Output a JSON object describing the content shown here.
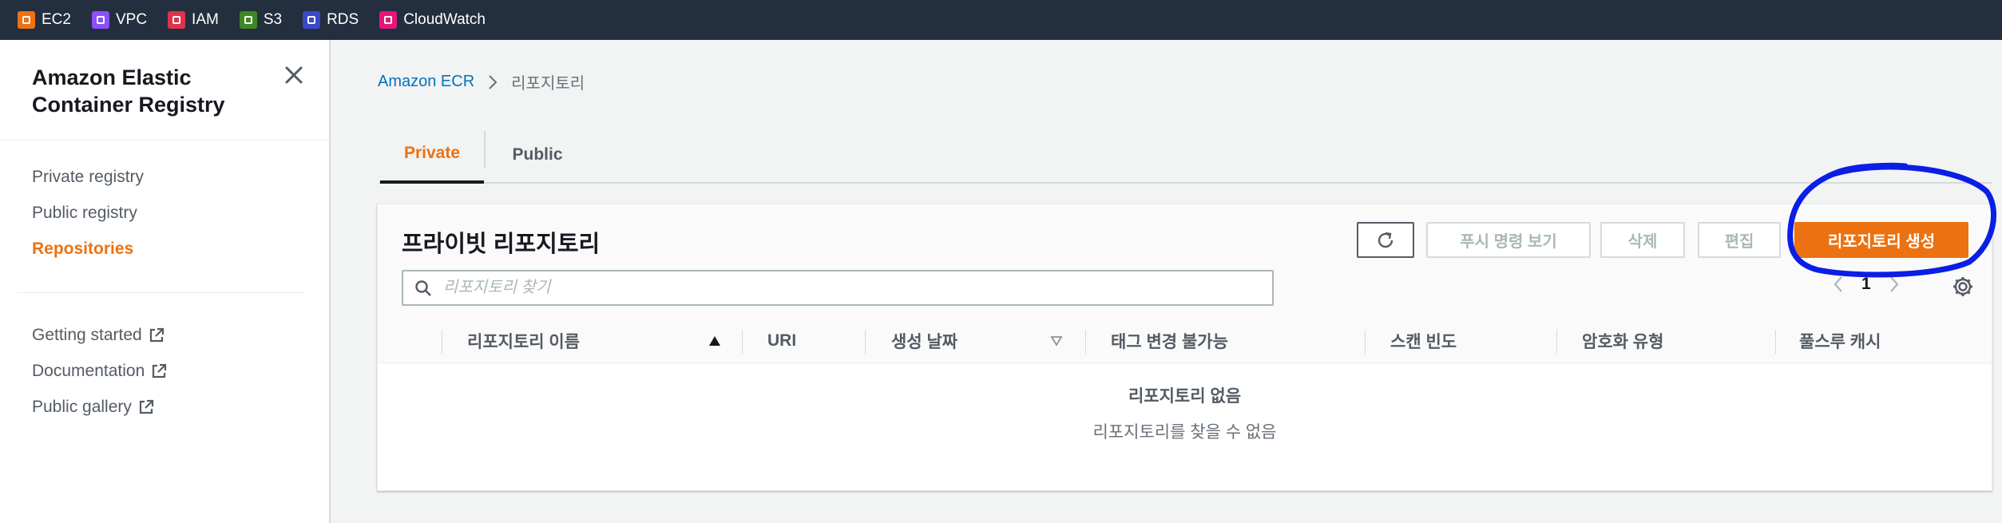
{
  "favorites": [
    {
      "label": "EC2",
      "color": "#ec7211"
    },
    {
      "label": "VPC",
      "color": "#8c4fff"
    },
    {
      "label": "IAM",
      "color": "#dd344c"
    },
    {
      "label": "S3",
      "color": "#3f8624"
    },
    {
      "label": "RDS",
      "color": "#3b48cc"
    },
    {
      "label": "CloudWatch",
      "color": "#e7157b"
    }
  ],
  "sidebar": {
    "title": "Amazon Elastic Container Registry",
    "nav": [
      "Private registry",
      "Public registry",
      "Repositories"
    ],
    "active": "Repositories",
    "links": [
      "Getting started",
      "Documentation",
      "Public gallery"
    ]
  },
  "breadcrumb": {
    "root": "Amazon ECR",
    "current": "리포지토리"
  },
  "tabs": {
    "private": "Private",
    "public": "Public"
  },
  "panel": {
    "title": "프라이빗 리포지토리",
    "buttons": {
      "push": "푸시 명령 보기",
      "delete": "삭제",
      "edit": "편집",
      "create": "리포지토리 생성"
    },
    "search_placeholder": "리포지토리 찾기",
    "page": "1",
    "columns": [
      "리포지토리 이름",
      "URI",
      "생성 날짜",
      "태그 변경 불가능",
      "스캔 빈도",
      "암호화 유형",
      "풀스루 캐시"
    ],
    "empty_title": "리포지토리 없음",
    "empty_subtitle": "리포지토리를 찾을 수 없음"
  },
  "colors": {
    "accent": "#ec7211",
    "link": "#0073bb",
    "annotation": "#0a1ee6"
  }
}
